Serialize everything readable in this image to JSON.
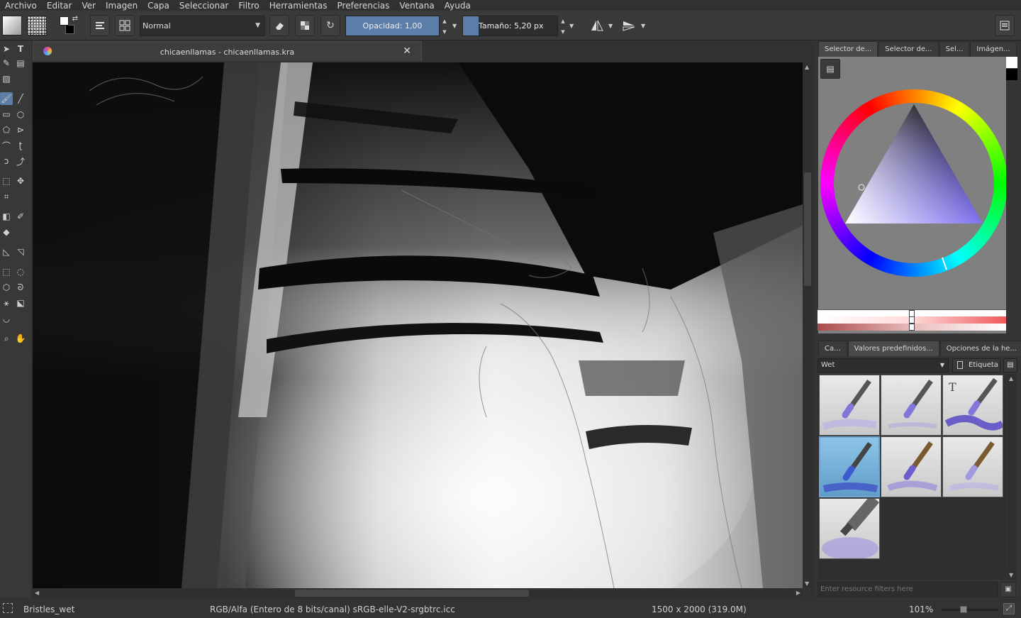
{
  "menu": [
    "Archivo",
    "Editar",
    "Ver",
    "Imagen",
    "Capa",
    "Seleccionar",
    "Filtro",
    "Herramientas",
    "Preferencias",
    "Ventana",
    "Ayuda"
  ],
  "toolbar": {
    "blend_mode": "Normal",
    "opacity_label": "Opacidad:  1,00",
    "opacity_value": 1.0,
    "size_label": "Tamaño:  5,20 px"
  },
  "document": {
    "tab_title": "chicaenllamas - chicaenllamas.kra"
  },
  "dock": {
    "top_tabs": [
      "Selector de...",
      "Selector de...",
      "Sel...",
      "Imágen..."
    ],
    "bottom_tabs": [
      "Ca...",
      "Valores predefinidos...",
      "Opciones de la he..."
    ],
    "preset_filter": "Wet",
    "tag_button": "Etiqueta",
    "filter_placeholder": "Enter resource filters here"
  },
  "status": {
    "brush": "Bristles_wet",
    "color_space": "RGB/Alfa (Entero de 8 bits/canal)  sRGB-elle-V2-srgbtrc.icc",
    "dimensions": "1500 x 2000 (319.0M)",
    "zoom": "101%"
  },
  "colors": {
    "accent": "#5b7fa8",
    "panel_bg": "#353535",
    "selector_bg": "#808080"
  }
}
